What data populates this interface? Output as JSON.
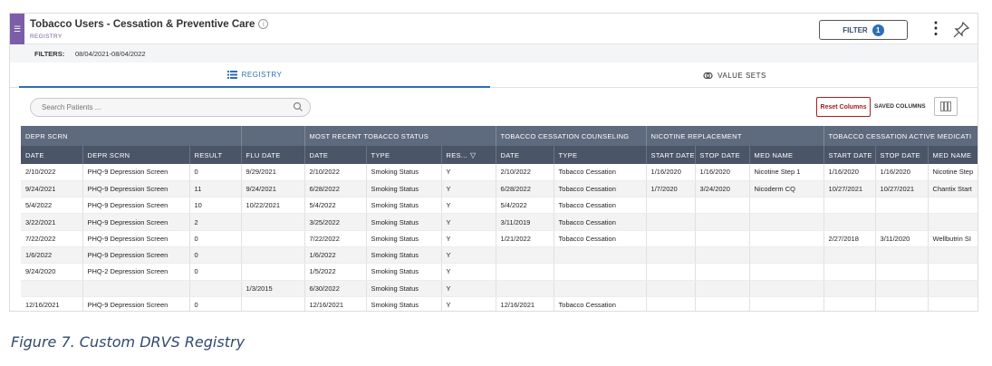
{
  "header": {
    "title": "Tobacco Users - Cessation & Preventive Care",
    "subtitle": "REGISTRY",
    "info_icon": "info-icon",
    "filter_label": "FILTER",
    "filter_count": "1",
    "kebab_icon": "vertical-dots-icon",
    "pin_icon": "pin-icon"
  },
  "filters": {
    "label": "FILTERS:",
    "value": "08/04/2021-08/04/2022"
  },
  "tabs": [
    {
      "label": "REGISTRY",
      "icon": "list-icon",
      "active": true
    },
    {
      "label": "VALUE SETS",
      "icon": "link-icon",
      "active": false
    }
  ],
  "toolbar": {
    "search_placeholder": "Search Patients ...",
    "reset_label": "Reset Columns",
    "saved_columns_label": "SAVED COLUMNS"
  },
  "colors": {
    "accent": "#2d6fb5",
    "brand_purple": "#7b5ea7",
    "header_dark": "#4a5568",
    "group_header": "#5e6b7e",
    "reset_red": "#a02020"
  },
  "table": {
    "groups": [
      {
        "label": "DEPR SCRN",
        "span": 3
      },
      {
        "label": "",
        "span": 1
      },
      {
        "label": "MOST RECENT TOBACCO STATUS",
        "span": 3
      },
      {
        "label": "TOBACCO CESSATION COUNSELING",
        "span": 2
      },
      {
        "label": "NICOTINE REPLACEMENT",
        "span": 3
      },
      {
        "label": "TOBACCO CESSATION ACTIVE MEDICATI",
        "span": 3
      }
    ],
    "columns": [
      "DATE",
      "DEPR SCRN",
      "RESULT",
      "FLU DATE",
      "DATE",
      "TYPE",
      "RES...",
      "DATE",
      "TYPE",
      "START DATE",
      "STOP DATE",
      "MED NAME",
      "START DATE",
      "STOP DATE",
      "MED NAME"
    ],
    "rows": [
      [
        "2/10/2022",
        "PHQ-9 Depression Screen",
        "0",
        "9/29/2021",
        "2/10/2022",
        "Smoking Status",
        "Y",
        "2/10/2022",
        "Tobacco Cessation",
        "1/16/2020",
        "1/16/2020",
        "Nicotine Step 1",
        "1/16/2020",
        "1/16/2020",
        "Nicotine Step"
      ],
      [
        "9/24/2021",
        "PHQ-9 Depression Screen",
        "11",
        "9/24/2021",
        "6/28/2022",
        "Smoking Status",
        "Y",
        "6/28/2022",
        "Tobacco Cessation",
        "1/7/2020",
        "3/24/2020",
        "Nicoderm CQ",
        "10/27/2021",
        "10/27/2021",
        "Chantix Start"
      ],
      [
        "5/4/2022",
        "PHQ-9 Depression Screen",
        "10",
        "10/22/2021",
        "5/4/2022",
        "Smoking Status",
        "Y",
        "5/4/2022",
        "Tobacco Cessation",
        "",
        "",
        "",
        "",
        "",
        ""
      ],
      [
        "3/22/2021",
        "PHQ-9 Depression Screen",
        "2",
        "",
        "3/25/2022",
        "Smoking Status",
        "Y",
        "3/11/2019",
        "Tobacco Cessation",
        "",
        "",
        "",
        "",
        "",
        ""
      ],
      [
        "7/22/2022",
        "PHQ-9 Depression Screen",
        "0",
        "",
        "7/22/2022",
        "Smoking Status",
        "Y",
        "1/21/2022",
        "Tobacco Cessation",
        "",
        "",
        "",
        "2/27/2018",
        "3/11/2020",
        "Wellbutrin SI"
      ],
      [
        "1/6/2022",
        "PHQ-9 Depression Screen",
        "0",
        "",
        "1/6/2022",
        "Smoking Status",
        "Y",
        "",
        "",
        "",
        "",
        "",
        "",
        "",
        ""
      ],
      [
        "9/24/2020",
        "PHQ-2 Depression Screen",
        "0",
        "",
        "1/5/2022",
        "Smoking Status",
        "Y",
        "",
        "",
        "",
        "",
        "",
        "",
        "",
        ""
      ],
      [
        "",
        "",
        "",
        "1/3/2015",
        "6/30/2022",
        "Smoking Status",
        "Y",
        "",
        "",
        "",
        "",
        "",
        "",
        "",
        ""
      ],
      [
        "12/16/2021",
        "PHQ-9 Depression Screen",
        "0",
        "",
        "12/16/2021",
        "Smoking Status",
        "Y",
        "12/16/2021",
        "Tobacco Cessation",
        "",
        "",
        "",
        "",
        "",
        ""
      ]
    ]
  },
  "caption": "Figure 7. Custom DRVS Registry"
}
